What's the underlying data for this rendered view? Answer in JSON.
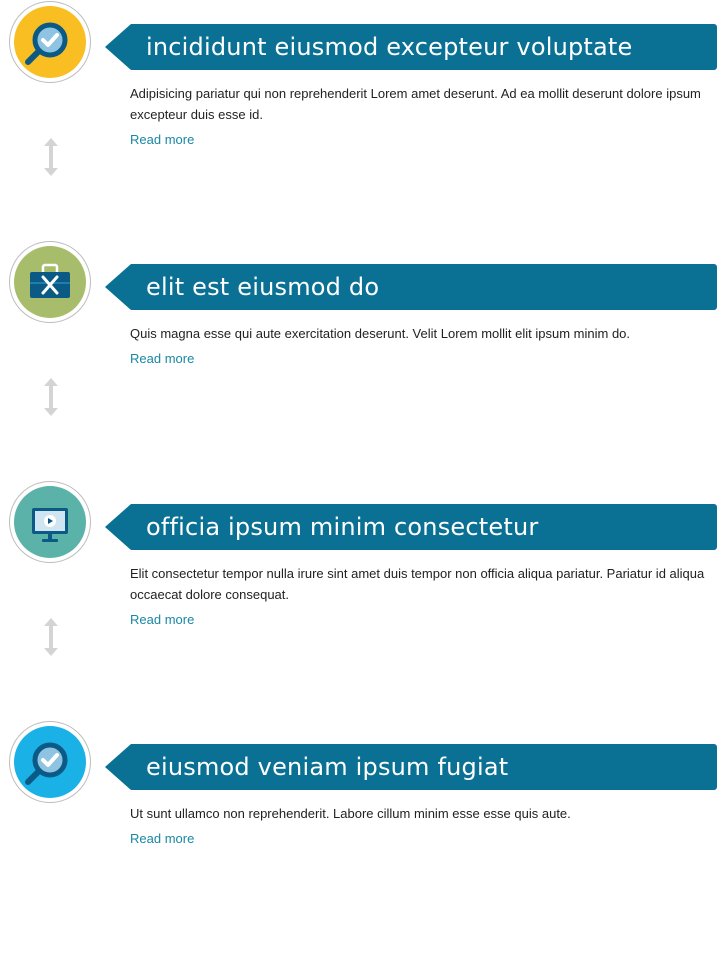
{
  "items": [
    {
      "title": "incididunt eiusmod excepteur voluptate",
      "description": "Adipisicing pariatur qui non reprehenderit Lorem amet deserunt. Ad ea mollit deserunt dolore ipsum excepteur duis esse id.",
      "link": "Read more",
      "icon": "magnifier-check-icon",
      "color": "#f8be22"
    },
    {
      "title": "elit est eiusmod do",
      "description": "Quis magna esse qui aute exercitation deserunt. Velit Lorem mollit elit ipsum minim do.",
      "link": "Read more",
      "icon": "toolbox-icon",
      "color": "#a8bd6c"
    },
    {
      "title": "officia ipsum minim consectetur",
      "description": "Elit consectetur tempor nulla irure sint amet duis tempor non officia aliqua pariatur. Pariatur id aliqua occaecat dolore consequat.",
      "link": "Read more",
      "icon": "monitor-play-icon",
      "color": "#5ab2a8"
    },
    {
      "title": "eiusmod veniam ipsum fugiat",
      "description": "Ut sunt ullamco non reprehenderit. Labore cillum minim esse esse quis aute.",
      "link": "Read more",
      "icon": "magnifier-check-icon",
      "color": "#1ab1e6"
    }
  ],
  "colors": {
    "header_bar": "#0b7194",
    "link": "#1788a6",
    "connector": "#d4d4d4"
  }
}
